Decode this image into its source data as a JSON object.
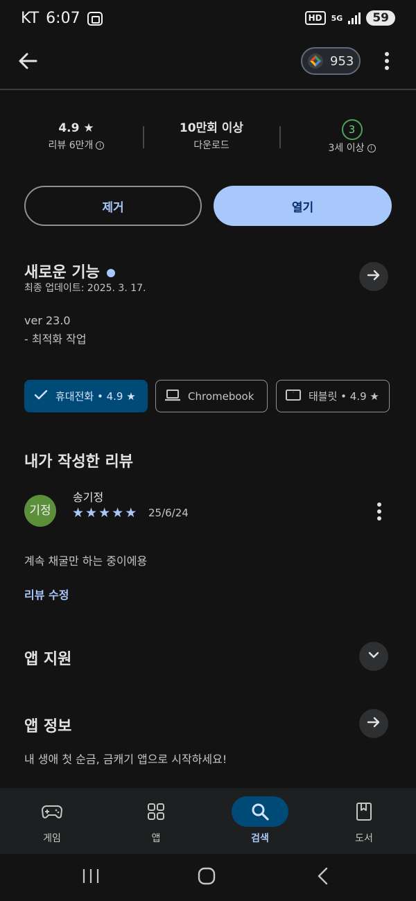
{
  "status_bar": {
    "carrier": "KT",
    "time": "6:07",
    "hd": "HD",
    "network": "5G",
    "battery": "59"
  },
  "app_bar": {
    "points": "953"
  },
  "stats": {
    "rating_value": "4.9",
    "rating_label": "리뷰 6만개",
    "downloads_value": "10만회 이상",
    "downloads_label": "다운로드",
    "age_badge": "3",
    "age_label": "3세 이상"
  },
  "actions": {
    "uninstall": "제거",
    "open": "열기"
  },
  "whats_new": {
    "title": "새로운 기능",
    "updated": "최종 업데이트: 2025. 3. 17.",
    "version": "ver 23.0",
    "notes": "- 최적화 작업"
  },
  "devices": [
    {
      "label": "휴대전화 • 4.9 ★",
      "selected": true
    },
    {
      "label": "Chromebook",
      "selected": false
    },
    {
      "label": "태블릿 • 4.9 ★",
      "selected": false
    }
  ],
  "my_review": {
    "title": "내가 작성한 리뷰",
    "avatar_text": "기정",
    "reviewer": "송기정",
    "stars": 5,
    "date": "25/6/24",
    "text": "계속 채굴만 하는 중이에용",
    "edit_label": "리뷰 수정"
  },
  "app_support": {
    "title": "앱 지원"
  },
  "app_info": {
    "title": "앱 정보",
    "description": "내 생애 첫 순금, 금캐기 앱으로 시작하세요!"
  },
  "bottom_nav": [
    {
      "label": "게임",
      "icon": "gamepad-icon",
      "active": false
    },
    {
      "label": "앱",
      "icon": "apps-grid-icon",
      "active": false
    },
    {
      "label": "검색",
      "icon": "search-icon",
      "active": true
    },
    {
      "label": "도서",
      "icon": "book-icon",
      "active": false
    }
  ],
  "colors": {
    "background": "#131314",
    "accent": "#a8c7fa",
    "selected_chip": "#004a77"
  }
}
